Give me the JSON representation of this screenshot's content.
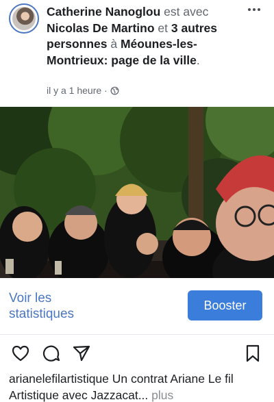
{
  "post": {
    "author": "Catherine Nanoglou",
    "with_text": "est avec",
    "tagged": "Nicolas De Martino",
    "and_text": "et",
    "others": "3 autres personnes",
    "at_text": "à",
    "place": "Méounes-les-Montrieux: page de la ville",
    "period": ".",
    "time": "il y a 1 heure ·",
    "privacy_icon": "globe-icon",
    "more_icon": "more-dots-icon"
  },
  "actions": {
    "stats_label": "Voir les statistiques",
    "boost_label": "Booster"
  },
  "instagram_bar": {
    "icons": [
      "heart-icon",
      "comment-icon",
      "share-icon",
      "bookmark-icon"
    ]
  },
  "caption": {
    "text": "arianelefilartistique Un contrat Ariane Le fil Artistique avec Jazzacat...",
    "more_label": " plus"
  },
  "colors": {
    "link_blue": "#4a76c2",
    "button_blue": "#3b7ddb",
    "muted_gray": "#606770"
  }
}
